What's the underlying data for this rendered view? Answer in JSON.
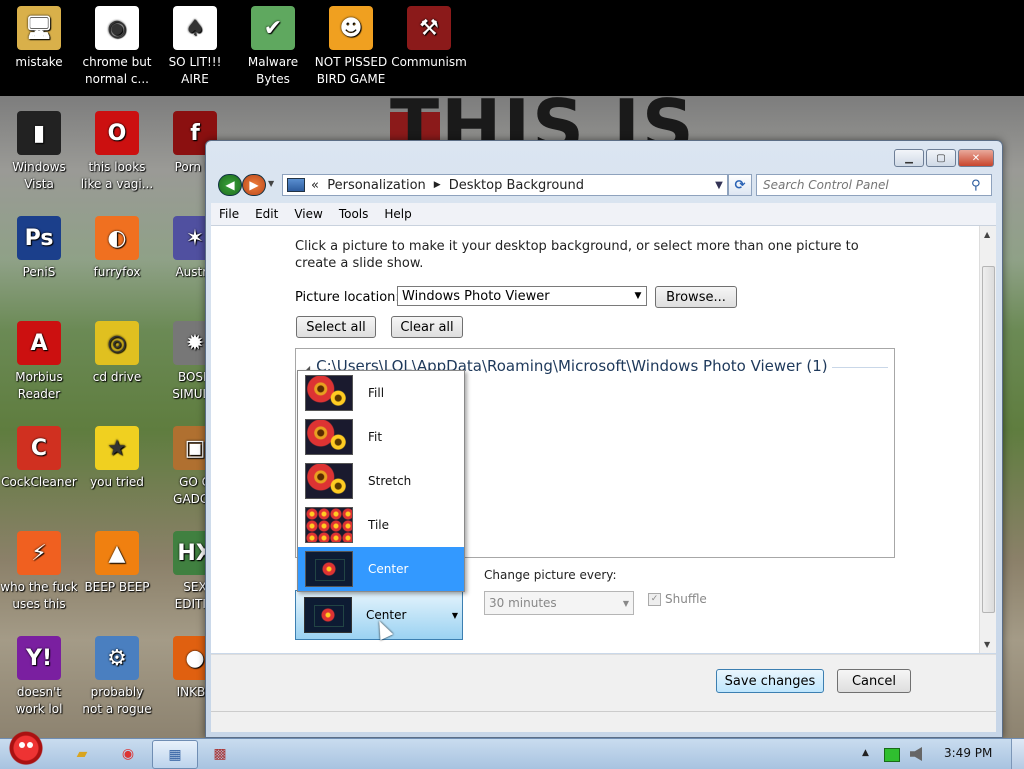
{
  "desktop": {
    "banner": "THIS IS",
    "icons": [
      {
        "label": "mistake",
        "icon": "computer-icon",
        "color": "#d9b04a",
        "glyph": "🖥"
      },
      {
        "label": "chrome but\nnormal c...",
        "icon": "chrome-icon",
        "color": "#ffffff",
        "glyph": "◉"
      },
      {
        "label": "SO LIT!!!\nAIRE",
        "icon": "solitaire-icon",
        "color": "#ffffff",
        "glyph": "♠"
      },
      {
        "label": "Malware\nBytes",
        "icon": "shield-icon",
        "color": "#5fa85f",
        "glyph": "✔"
      },
      {
        "label": "NOT PISSED\nBIRD GAME",
        "icon": "pig-icon",
        "color": "#f0a020",
        "glyph": "☻"
      },
      {
        "label": "Communism",
        "icon": "communism-icon",
        "color": "#8b1a1a",
        "glyph": "⚒"
      },
      {
        "label": "Windows\nVista",
        "icon": "bin-icon",
        "color": "#222222",
        "glyph": "▮"
      },
      {
        "label": "this looks\nlike a vagi...",
        "icon": "opera-icon",
        "color": "#cc1010",
        "glyph": "O"
      },
      {
        "label": "Porn Pl",
        "icon": "flash-icon",
        "color": "#8b1010",
        "glyph": "f"
      },
      {
        "label": "PeniS",
        "icon": "photoshop-icon",
        "color": "#1b3f8b",
        "glyph": "Ps"
      },
      {
        "label": "furryfox",
        "icon": "firefox-icon",
        "color": "#f07020",
        "glyph": "◐"
      },
      {
        "label": "Austra",
        "icon": "spider-icon",
        "color": "#5050a0",
        "glyph": "✶"
      },
      {
        "label": "Morbius\nReader",
        "icon": "pdf-icon",
        "color": "#cc1010",
        "glyph": "A"
      },
      {
        "label": "cd drive",
        "icon": "cd-icon",
        "color": "#e0c020",
        "glyph": "◎"
      },
      {
        "label": "BOSN\nSIMULA",
        "icon": "gear-icon",
        "color": "#777777",
        "glyph": "✹"
      },
      {
        "label": "CockCleaner",
        "icon": "ccleaner-icon",
        "color": "#d03020",
        "glyph": "C"
      },
      {
        "label": "you tried",
        "icon": "star-icon",
        "color": "#f0d020",
        "glyph": "★"
      },
      {
        "label": "GO G\nGADGE",
        "icon": "briefcase-icon",
        "color": "#b07030",
        "glyph": "▣"
      },
      {
        "label": "who the fuck\nuses this",
        "icon": "winamp-icon",
        "color": "#f06020",
        "glyph": "⚡"
      },
      {
        "label": "BEEP BEEP",
        "icon": "vlc-icon",
        "color": "#f08010",
        "glyph": "▲"
      },
      {
        "label": "SEX\nEDITIO",
        "icon": "hx-icon",
        "color": "#408040",
        "glyph": "HX"
      },
      {
        "label": "doesn't\nwork lol",
        "icon": "yahoo-icon",
        "color": "#7a1fa0",
        "glyph": "Y!"
      },
      {
        "label": "probably\nnot a rogue",
        "icon": "settings-icon",
        "color": "#4a7fc0",
        "glyph": "⚙"
      },
      {
        "label": "INKBA",
        "icon": "pin-icon",
        "color": "#e06010",
        "glyph": "●"
      }
    ]
  },
  "window": {
    "breadcrumb": [
      "Personalization",
      "Desktop Background"
    ],
    "search_placeholder": "Search Control Panel",
    "menu": [
      "File",
      "Edit",
      "View",
      "Tools",
      "Help"
    ],
    "intro": "Click a picture to make it your desktop background, or select more than one picture to create a slide show.",
    "picture_location_label": "Picture location:",
    "picture_location_value": "Windows Photo Viewer",
    "browse_label": "Browse...",
    "select_all_label": "Select all",
    "clear_all_label": "Clear all",
    "gallery_header": "C:\\Users\\LOL\\AppData\\Roaming\\Microsoft\\Windows Photo Viewer (1)",
    "position_options": [
      {
        "label": "Fill",
        "style": "flower"
      },
      {
        "label": "Fit",
        "style": "flower"
      },
      {
        "label": "Stretch",
        "style": "flower"
      },
      {
        "label": "Tile",
        "style": "tile"
      },
      {
        "label": "Center",
        "style": "center"
      }
    ],
    "position_selected": "Center",
    "change_picture_label": "Change picture every:",
    "interval_value": "30 minutes",
    "shuffle_label": "Shuffle",
    "save_label": "Save changes",
    "cancel_label": "Cancel"
  },
  "taskbar": {
    "clock": "3:49 PM"
  }
}
